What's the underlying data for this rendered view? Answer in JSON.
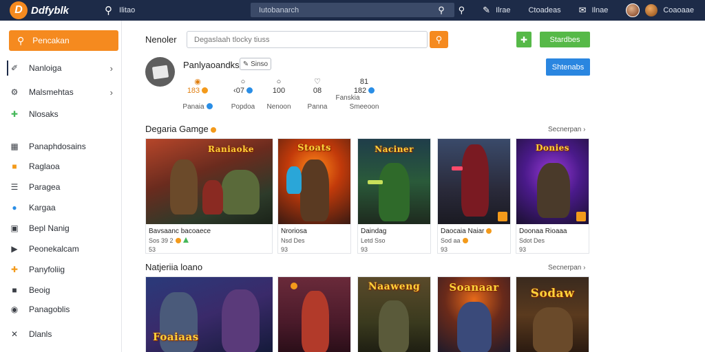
{
  "topbar": {
    "logo_text": "Ddfyblk",
    "link": "Ilitao",
    "search_placeholder": "Iutobanarch",
    "right": [
      "Ilrae",
      "Ctoadeas",
      "Ilnae",
      "Coaoaae"
    ]
  },
  "sidebar": {
    "search_label": "Pencakan",
    "items": [
      {
        "label": "Nanloiga",
        "icon": "pen-icon"
      },
      {
        "label": "Malsmehtas",
        "icon": "gear-icon"
      },
      {
        "label": "Nlosaks",
        "icon": "puzzle-icon"
      },
      {
        "label": "Panaphdosains",
        "icon": "grid-icon"
      },
      {
        "label": "Raglaoa",
        "icon": "folder-icon"
      },
      {
        "label": "Paragea",
        "icon": "list-icon"
      },
      {
        "label": "Kargaa",
        "icon": "globe-icon"
      },
      {
        "label": "Bepl Nanig",
        "icon": "document-icon"
      },
      {
        "label": "Peonekalcam",
        "icon": "tag-icon"
      },
      {
        "label": "Panyfoliig",
        "icon": "puzzle-icon"
      },
      {
        "label": "Beoig",
        "icon": "folder-icon"
      },
      {
        "label": "Panagoblis",
        "icon": "pin-icon"
      },
      {
        "label": "Dlanls",
        "icon": "tools-icon"
      }
    ]
  },
  "main": {
    "header_label": "Nenoler",
    "filter_placeholder": "Degaslaah tlocky tiuss",
    "green_button": "Stardbes",
    "blue_button": "Shtenabs",
    "profile": {
      "name": "Panlyaoandks",
      "tag": "Sinso"
    },
    "stats": [
      {
        "value": "183",
        "label": "Panaia"
      },
      {
        "value": "‹07",
        "label": "Popdoa"
      },
      {
        "value": "100",
        "label": "Nenoon"
      },
      {
        "value": "08",
        "label": "Panna"
      },
      {
        "value": "",
        "label": "Fanskia"
      },
      {
        "value": "182",
        "label": "Smeeoon"
      }
    ],
    "sections": [
      {
        "title": "Degaria Gamge",
        "more": "Secnerpan",
        "cards": [
          {
            "art_title": "Raniaoke",
            "title": "Bavsaanc bacoaece",
            "meta": "Sos 39 2",
            "rating": "53"
          },
          {
            "art_title": "Stoats",
            "title": "Nroriosa",
            "meta": "Nsd Des",
            "rating": "93"
          },
          {
            "art_title": "Naciner",
            "title": "Daindag",
            "meta": "Letd Sso",
            "rating": "93"
          },
          {
            "art_title": "",
            "title": "Daocaia Naiar",
            "meta": "Sod aa",
            "rating": "93"
          },
          {
            "art_title": "Donies",
            "title": "Doonaa Rioaaa",
            "meta": "Sdot Des",
            "rating": "93"
          }
        ]
      },
      {
        "title": "Natjeriia loano",
        "more": "Secnerpan",
        "cards": [
          {
            "art_title": "Foaiaas"
          },
          {
            "art_title": ""
          },
          {
            "art_title": "Naaweng"
          },
          {
            "art_title": "Soanaar"
          },
          {
            "art_title": "Sodaw"
          }
        ]
      }
    ]
  },
  "colors": {
    "topbar": "#1d2b48",
    "accent_orange": "#f58a1f",
    "accent_green": "#56b948",
    "accent_blue": "#2a86e0"
  }
}
